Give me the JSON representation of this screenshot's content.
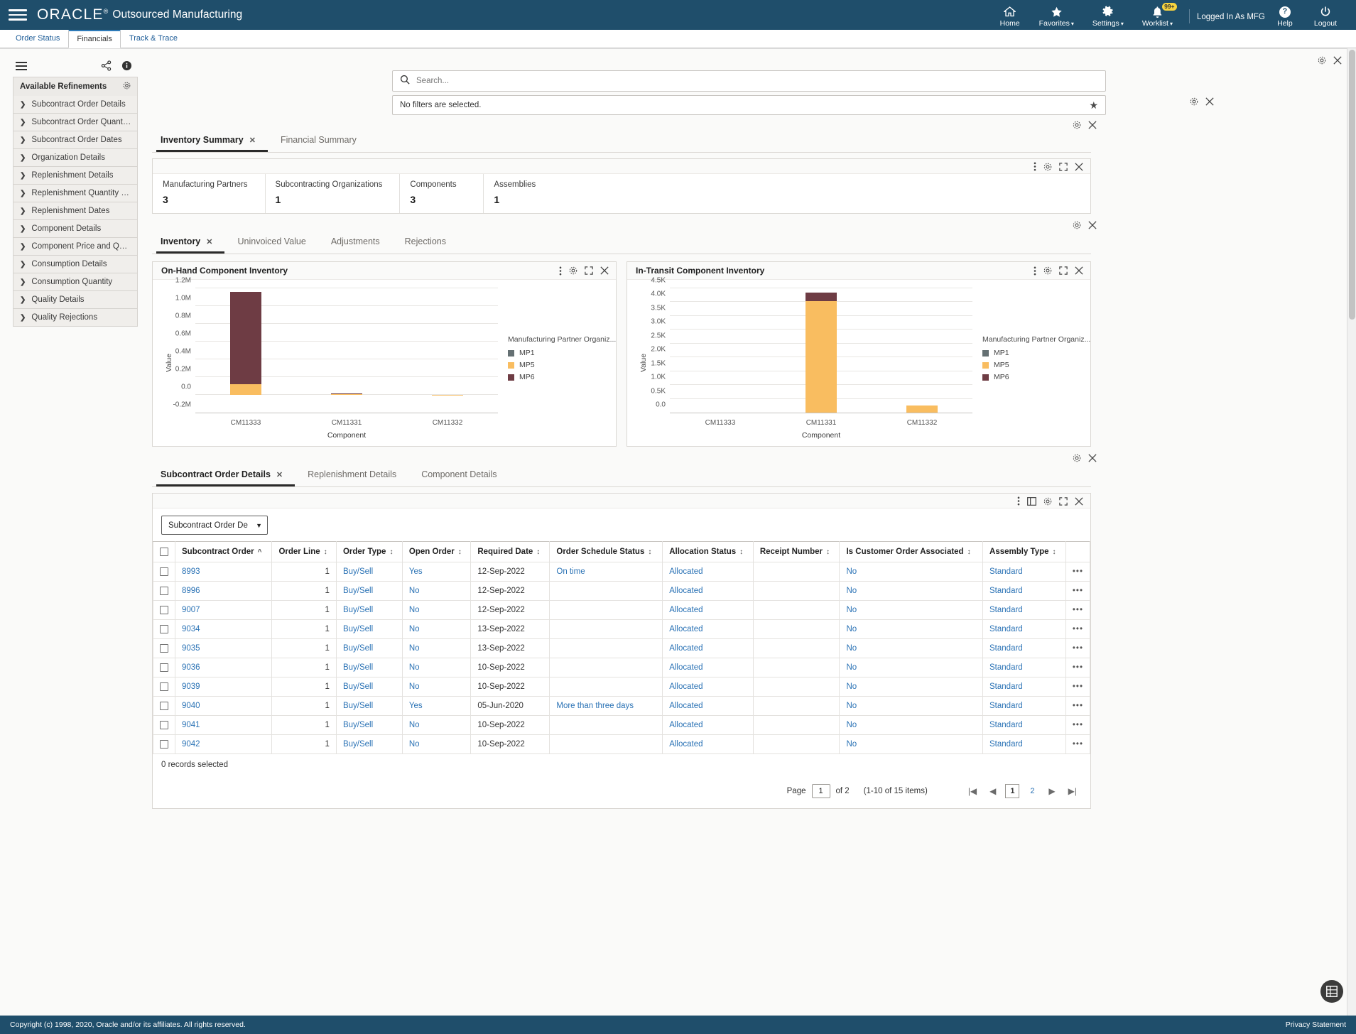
{
  "header": {
    "brand": "ORACLE",
    "brand_sup": "®",
    "app_title": "Outsourced Manufacturing",
    "menu_icon": "hamburger-icon",
    "items": [
      {
        "label": "Home",
        "icon": "home-icon",
        "caret": false
      },
      {
        "label": "Favorites",
        "icon": "star-icon",
        "caret": true
      },
      {
        "label": "Settings",
        "icon": "gear-icon",
        "caret": true
      },
      {
        "label": "Worklist",
        "icon": "bell-icon",
        "caret": true,
        "badge": "99+"
      }
    ],
    "logged_in": "Logged In As MFG",
    "help": "Help",
    "logout": "Logout"
  },
  "app_tabs": [
    {
      "label": "Order Status",
      "active": false
    },
    {
      "label": "Financials",
      "active": true
    },
    {
      "label": "Track & Trace",
      "active": false
    }
  ],
  "sidebar": {
    "title": "Available Refinements",
    "items": [
      {
        "label": "Subcontract Order Details"
      },
      {
        "label": "Subcontract Order Quantity an..."
      },
      {
        "label": "Subcontract Order Dates"
      },
      {
        "label": "Organization Details"
      },
      {
        "label": "Replenishment Details"
      },
      {
        "label": "Replenishment Quantity and Price"
      },
      {
        "label": "Replenishment Dates"
      },
      {
        "label": "Component Details"
      },
      {
        "label": "Component Price and Quantity"
      },
      {
        "label": "Consumption Details"
      },
      {
        "label": "Consumption Quantity"
      },
      {
        "label": "Quality Details"
      },
      {
        "label": "Quality Rejections"
      }
    ]
  },
  "search": {
    "placeholder": "Search...",
    "value": "",
    "filter_text": "No filters are selected."
  },
  "summary": {
    "tabs": [
      {
        "label": "Inventory Summary",
        "active": true,
        "closable": true
      },
      {
        "label": "Financial Summary",
        "active": false,
        "closable": false
      }
    ],
    "metrics": [
      {
        "label": "Manufacturing Partners",
        "value": "3"
      },
      {
        "label": "Subcontracting Organizations",
        "value": "1"
      },
      {
        "label": "Components",
        "value": "3"
      },
      {
        "label": "Assemblies",
        "value": "1"
      }
    ]
  },
  "inventory": {
    "tabs": [
      {
        "label": "Inventory",
        "active": true,
        "closable": true
      },
      {
        "label": "Uninvoiced Value",
        "active": false,
        "closable": false
      },
      {
        "label": "Adjustments",
        "active": false,
        "closable": false
      },
      {
        "label": "Rejections",
        "active": false,
        "closable": false
      }
    ]
  },
  "chart_data": [
    {
      "type": "bar",
      "stacked": true,
      "title": "On-Hand Component Inventory",
      "xlabel": "Component",
      "ylabel": "Value",
      "categories": [
        "CM11333",
        "CM11331",
        "CM11332"
      ],
      "yticks": [
        "1.2M",
        "1.0M",
        "0.8M",
        "0.6M",
        "0.4M",
        "0.2M",
        "0.0",
        "-0.2M"
      ],
      "ylim": [
        -200000,
        1200000
      ],
      "grid": true,
      "legend_title": "Manufacturing Partner Organiz...",
      "legend_position": "right",
      "series": [
        {
          "name": "MP1",
          "color": "#657073",
          "values": [
            0,
            0,
            0
          ]
        },
        {
          "name": "MP5",
          "color": "#f9bd60",
          "values": [
            124000,
            8000,
            2000
          ]
        },
        {
          "name": "MP6",
          "color": "#6e3c44",
          "values": [
            1040000,
            9000,
            0
          ]
        }
      ]
    },
    {
      "type": "bar",
      "stacked": true,
      "title": "In-Transit Component Inventory",
      "xlabel": "Component",
      "ylabel": "Value",
      "categories": [
        "CM11333",
        "CM11331",
        "CM11332"
      ],
      "yticks": [
        "4.5K",
        "4.0K",
        "3.5K",
        "3.0K",
        "2.5K",
        "2.0K",
        "1.5K",
        "1.0K",
        "0.5K",
        "0.0"
      ],
      "ylim": [
        0,
        4500
      ],
      "grid": true,
      "legend_title": "Manufacturing Partner Organiz...",
      "legend_position": "right",
      "series": [
        {
          "name": "MP1",
          "color": "#657073",
          "values": [
            0,
            0,
            0
          ]
        },
        {
          "name": "MP5",
          "color": "#f9bd60",
          "values": [
            0,
            4050,
            260
          ]
        },
        {
          "name": "MP6",
          "color": "#6e3c44",
          "values": [
            0,
            290,
            0
          ]
        }
      ]
    }
  ],
  "details": {
    "tabs": [
      {
        "label": "Subcontract Order Details",
        "active": true,
        "closable": true
      },
      {
        "label": "Replenishment Details",
        "active": false,
        "closable": false
      },
      {
        "label": "Component Details",
        "active": false,
        "closable": false
      }
    ],
    "view_select": "Subcontract Order De",
    "columns": [
      {
        "label": "Subcontract Order",
        "sort": "asc"
      },
      {
        "label": "Order Line",
        "sort": "both"
      },
      {
        "label": "Order Type",
        "sort": "both"
      },
      {
        "label": "Open Order",
        "sort": "both"
      },
      {
        "label": "Required Date",
        "sort": "both"
      },
      {
        "label": "Order Schedule Status",
        "sort": "both"
      },
      {
        "label": "Allocation Status",
        "sort": "both"
      },
      {
        "label": "Receipt Number",
        "sort": "both"
      },
      {
        "label": "Is Customer Order Associated",
        "sort": "both"
      },
      {
        "label": "Assembly Type",
        "sort": "both"
      }
    ],
    "rows": [
      {
        "order": "8993",
        "line": "1",
        "type": "Buy/Sell",
        "open": "Yes",
        "required": "12-Sep-2022",
        "schedule": "On time",
        "allocation": "Allocated",
        "receipt": "",
        "customer": "No",
        "assembly": "Standard"
      },
      {
        "order": "8996",
        "line": "1",
        "type": "Buy/Sell",
        "open": "No",
        "required": "12-Sep-2022",
        "schedule": "",
        "allocation": "Allocated",
        "receipt": "",
        "customer": "No",
        "assembly": "Standard"
      },
      {
        "order": "9007",
        "line": "1",
        "type": "Buy/Sell",
        "open": "No",
        "required": "12-Sep-2022",
        "schedule": "",
        "allocation": "Allocated",
        "receipt": "",
        "customer": "No",
        "assembly": "Standard"
      },
      {
        "order": "9034",
        "line": "1",
        "type": "Buy/Sell",
        "open": "No",
        "required": "13-Sep-2022",
        "schedule": "",
        "allocation": "Allocated",
        "receipt": "",
        "customer": "No",
        "assembly": "Standard"
      },
      {
        "order": "9035",
        "line": "1",
        "type": "Buy/Sell",
        "open": "No",
        "required": "13-Sep-2022",
        "schedule": "",
        "allocation": "Allocated",
        "receipt": "",
        "customer": "No",
        "assembly": "Standard"
      },
      {
        "order": "9036",
        "line": "1",
        "type": "Buy/Sell",
        "open": "No",
        "required": "10-Sep-2022",
        "schedule": "",
        "allocation": "Allocated",
        "receipt": "",
        "customer": "No",
        "assembly": "Standard"
      },
      {
        "order": "9039",
        "line": "1",
        "type": "Buy/Sell",
        "open": "No",
        "required": "10-Sep-2022",
        "schedule": "",
        "allocation": "Allocated",
        "receipt": "",
        "customer": "No",
        "assembly": "Standard"
      },
      {
        "order": "9040",
        "line": "1",
        "type": "Buy/Sell",
        "open": "Yes",
        "required": "05-Jun-2020",
        "schedule": "More than three days",
        "allocation": "Allocated",
        "receipt": "",
        "customer": "No",
        "assembly": "Standard"
      },
      {
        "order": "9041",
        "line": "1",
        "type": "Buy/Sell",
        "open": "No",
        "required": "10-Sep-2022",
        "schedule": "",
        "allocation": "Allocated",
        "receipt": "",
        "customer": "No",
        "assembly": "Standard"
      },
      {
        "order": "9042",
        "line": "1",
        "type": "Buy/Sell",
        "open": "No",
        "required": "10-Sep-2022",
        "schedule": "",
        "allocation": "Allocated",
        "receipt": "",
        "customer": "No",
        "assembly": "Standard"
      }
    ],
    "records_selected": "0 records selected",
    "pager": {
      "page_label": "Page",
      "page_value": "1",
      "of_label": "of 2",
      "range": "(1-10 of 15 items)",
      "pages": [
        "1",
        "2"
      ],
      "active_page": "1"
    }
  },
  "footer": {
    "copyright": "Copyright (c) 1998, 2020, Oracle and/or its affiliates. All rights reserved.",
    "privacy": "Privacy Statement"
  }
}
